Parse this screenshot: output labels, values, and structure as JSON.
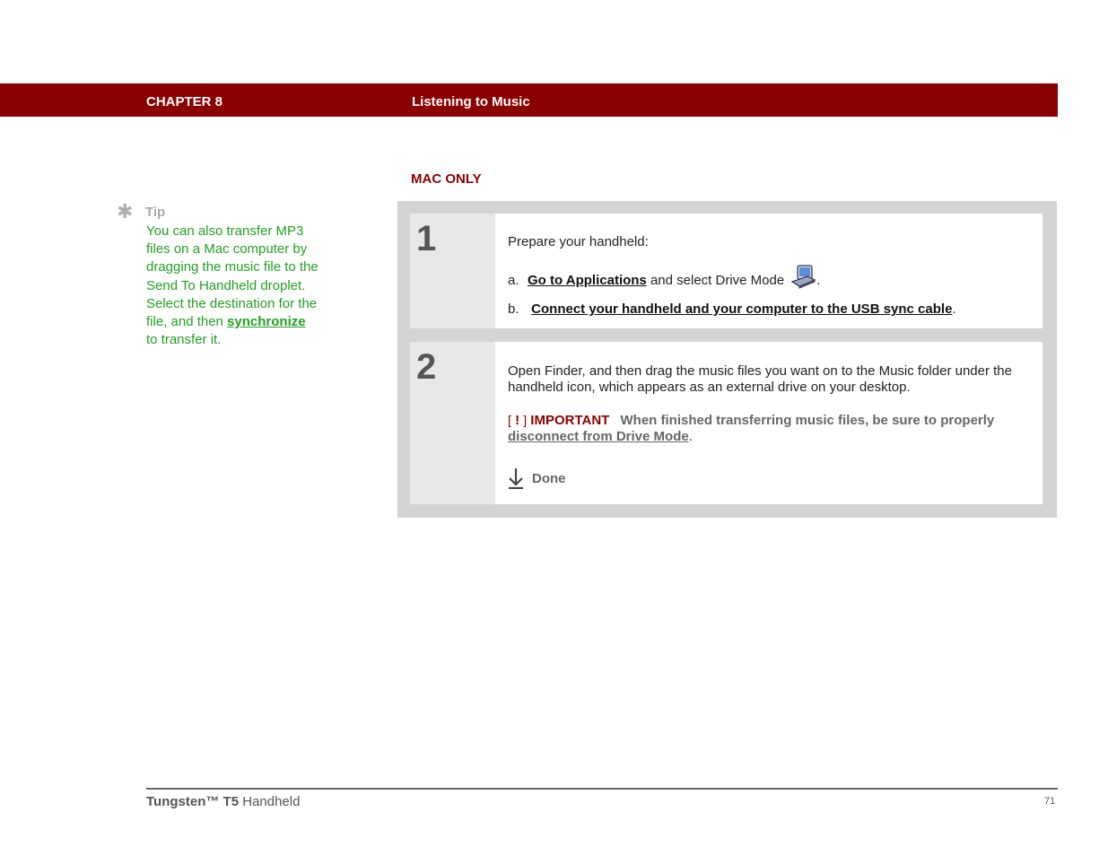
{
  "header": {
    "chapter": "CHAPTER 8",
    "title": "Listening to Music"
  },
  "section_label": "MAC ONLY",
  "tip": {
    "title": "Tip",
    "text_before": "You can also transfer MP3 files on a Mac computer by dragging the music file to the Send To Handheld droplet. Select the destination for the file, and then ",
    "link": "synchronize",
    "text_after": " to transfer it."
  },
  "steps": [
    {
      "number": "1",
      "intro": "Prepare your handheld:",
      "items": [
        {
          "marker": "a.",
          "link": "Go to Applications",
          "text": " and select Drive Mode",
          "suffix": "."
        },
        {
          "marker": "b.",
          "link": "Connect your handheld and your computer to the USB sync cable",
          "suffix": "."
        }
      ]
    },
    {
      "number": "2",
      "text": "Open Finder, and then drag the music files you want on to the Music folder under the handheld icon, which appears as an external drive on your desktop.",
      "important": {
        "bracket_open": "[",
        "bang": "!",
        "bracket_close": "]",
        "label": "IMPORTANT",
        "text": "When finished transferring music files, be sure to properly ",
        "link": "disconnect from Drive Mode",
        "suffix": "."
      },
      "done_label": "Done"
    }
  ],
  "footer": {
    "product_bold": "Tungsten™ T5",
    "product_rest": " Handheld",
    "page": "71"
  },
  "icons": {
    "tip": "asterisk-icon",
    "drive_mode": "drive-mode-icon",
    "done": "done-arrow-icon"
  },
  "colors": {
    "header_bg": "#8b0000",
    "tip_text": "#22a022",
    "important": "#8b0000",
    "frame": "#d4d4d4"
  }
}
